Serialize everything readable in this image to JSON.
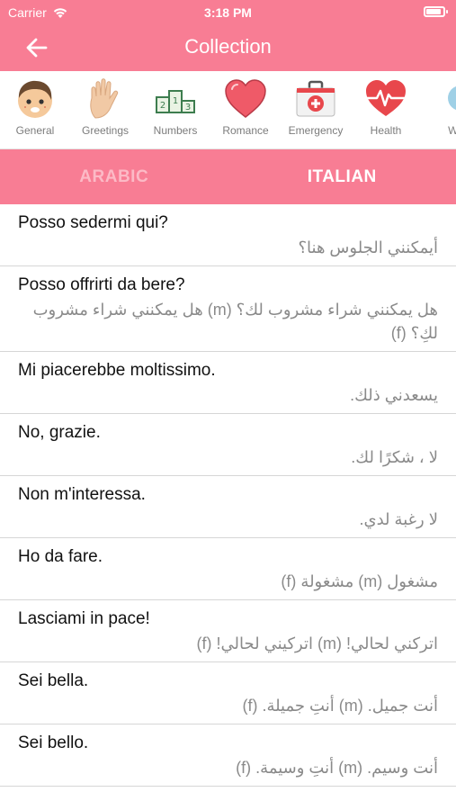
{
  "status": {
    "carrier": "Carrier",
    "time": "3:18 PM",
    "battery_level": 0.9
  },
  "header": {
    "title": "Collection"
  },
  "colors": {
    "accent": "#f87d94",
    "inactive_tab": "#fcbac6"
  },
  "categories": [
    {
      "label": "General",
      "icon": "boy-face-icon"
    },
    {
      "label": "Greetings",
      "icon": "waving-hand-icon"
    },
    {
      "label": "Numbers",
      "icon": "podium-numbers-icon"
    },
    {
      "label": "Romance",
      "icon": "heart-icon"
    },
    {
      "label": "Emergency",
      "icon": "first-aid-kit-icon"
    },
    {
      "label": "Health",
      "icon": "heartbeat-icon"
    },
    {
      "label": "We",
      "icon": "weather-icon"
    }
  ],
  "tabs": {
    "left": "ARABIC",
    "right": "ITALIAN",
    "active": "right"
  },
  "phrases": [
    {
      "phrase": "Posso sedermi qui?",
      "translation": "أيمكنني الجلوس هنا؟"
    },
    {
      "phrase": "Posso offrirti da bere?",
      "translation": "هل يمكنني شراء مشروب لك؟ (m)  هل يمكنني شراء مشروب لكِ؟ (f)"
    },
    {
      "phrase": "Mi piacerebbe moltissimo.",
      "translation": "يسعدني ذلك."
    },
    {
      "phrase": "No, grazie.",
      "translation": "لا ، شكرًا لك."
    },
    {
      "phrase": "Non m'interessa.",
      "translation": "لا رغبة لدي."
    },
    {
      "phrase": "Ho da fare.",
      "translation": "مشغول (m)  مشغولة (f)"
    },
    {
      "phrase": "Lasciami in pace!",
      "translation": "اتركني لحالي! (m)  اتركيني لحالي! (f)"
    },
    {
      "phrase": "Sei bella.",
      "translation": "أنت جميل. (m)  أنتِ جميلة. (f)"
    },
    {
      "phrase": "Sei bello.",
      "translation": "أنت وسيم. (m)  أنتِ وسيمة. (f)"
    }
  ]
}
